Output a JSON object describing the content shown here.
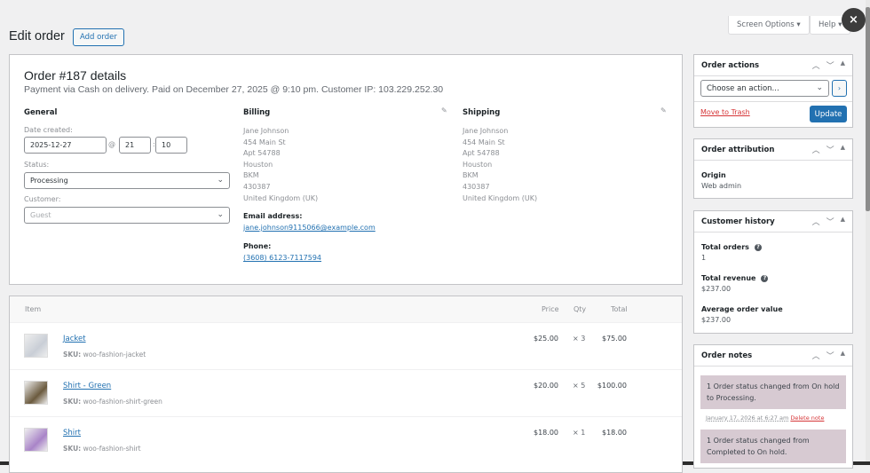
{
  "header": {
    "title": "Edit order",
    "add_order": "Add order",
    "screen_options": "Screen Options ▾",
    "help": "Help ▾",
    "close": "×"
  },
  "order": {
    "title": "Order #187 details",
    "meta": "Payment via Cash on delivery. Paid on December 27, 2025 @ 9:10 pm. Customer IP: 103.229.252.30",
    "general": {
      "heading": "General",
      "date_label": "Date created:",
      "date": "2025-12-27",
      "at": "@",
      "hour": "21",
      "colon": ":",
      "minute": "10",
      "status_label": "Status:",
      "status": "Processing",
      "customer_label": "Customer:",
      "customer_placeholder": "Guest"
    },
    "billing": {
      "heading": "Billing",
      "lines": [
        "Jane Johnson",
        "454 Main St",
        "Apt 54788",
        "Houston",
        "BKM",
        "430387",
        "United Kingdom (UK)"
      ],
      "email_label": "Email address:",
      "email": "jane.johnson9115066@example.com",
      "phone_label": "Phone:",
      "phone": "(3608) 6123-7117594"
    },
    "shipping": {
      "heading": "Shipping",
      "lines": [
        "Jane Johnson",
        "454 Main St",
        "Apt 54788",
        "Houston",
        "BKM",
        "430387",
        "United Kingdom (UK)"
      ]
    }
  },
  "items": {
    "headers": {
      "item": "Item",
      "price": "Price",
      "qty": "Qty",
      "total": "Total"
    },
    "rows": [
      {
        "name": "Jacket",
        "sku_label": "SKU:",
        "sku": "woo-fashion-jacket",
        "price": "$25.00",
        "qty": "× 3",
        "total": "$75.00",
        "thumb_color": "#c9ced6"
      },
      {
        "name": "Shirt - Green",
        "sku_label": "SKU:",
        "sku": "woo-fashion-shirt-green",
        "price": "$20.00",
        "qty": "× 5",
        "total": "$100.00",
        "thumb_color": "#6b5a3e"
      },
      {
        "name": "Shirt",
        "sku_label": "SKU:",
        "sku": "woo-fashion-shirt",
        "price": "$18.00",
        "qty": "× 1",
        "total": "$18.00",
        "thumb_color": "#a984c8"
      }
    ]
  },
  "sidebar": {
    "actions": {
      "title": "Order actions",
      "select": "Choose an action...",
      "go": "›",
      "trash": "Move to Trash",
      "update": "Update"
    },
    "attribution": {
      "title": "Order attribution",
      "origin_label": "Origin",
      "origin": "Web admin"
    },
    "history": {
      "title": "Customer history",
      "orders_label": "Total orders",
      "orders": "1",
      "revenue_label": "Total revenue",
      "revenue": "$237.00",
      "aov_label": "Average order value",
      "aov": "$237.00",
      "help": "?"
    },
    "notes": {
      "title": "Order notes",
      "items": [
        {
          "text": "1 Order status changed from On hold to Processing.",
          "date": "January 17, 2026 at 6:27 am",
          "delete": "Delete note"
        },
        {
          "text": "1 Order status changed from Completed to On hold."
        }
      ]
    },
    "ctrl_up": "︿",
    "ctrl_down": "﹀",
    "ctrl_toggle": "▲"
  }
}
